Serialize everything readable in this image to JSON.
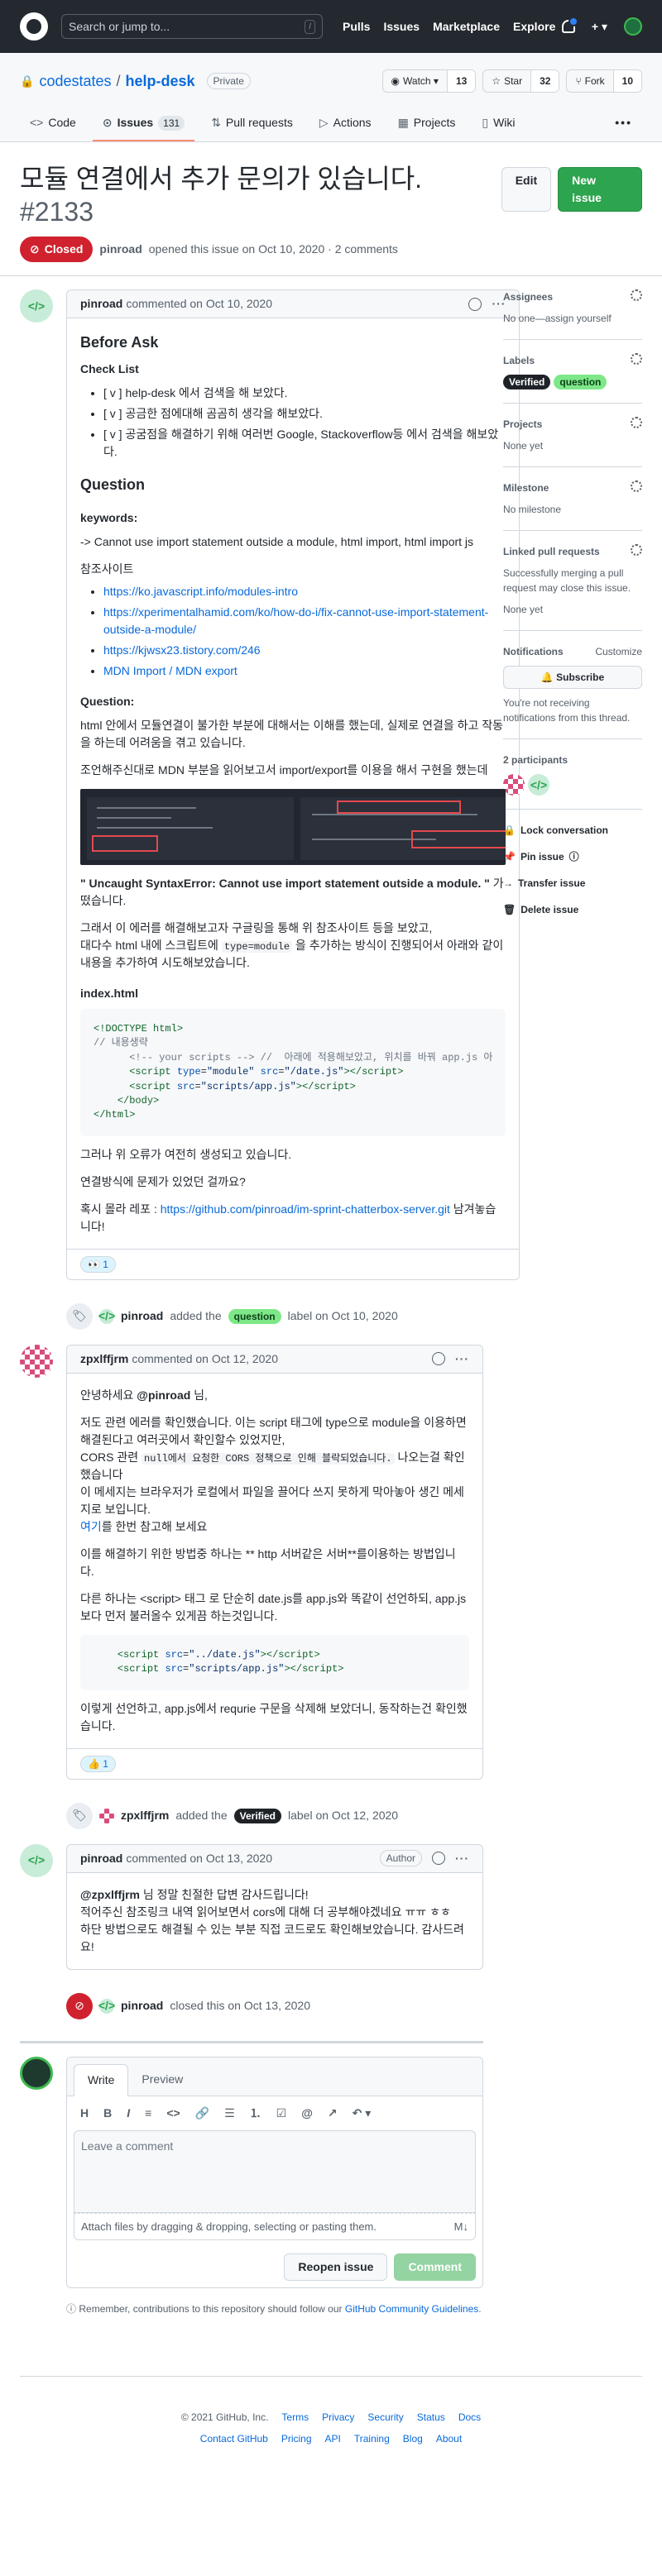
{
  "header": {
    "search_placeholder": "Search or jump to...",
    "slash": "/",
    "nav": [
      "Pulls",
      "Issues",
      "Marketplace",
      "Explore"
    ],
    "plus": "+ ▾"
  },
  "repo": {
    "owner": "codestates",
    "separator": "/",
    "name": "help-desk",
    "visibility": "Private",
    "watch_label": "Watch ▾",
    "watch_count": "13",
    "star_label": "Star",
    "star_count": "32",
    "fork_label": "Fork",
    "fork_count": "10",
    "tabs": [
      {
        "label": "Code",
        "icon": "<>"
      },
      {
        "label": "Issues",
        "icon": "⊙",
        "count": "131"
      },
      {
        "label": "Pull requests",
        "icon": "⇅"
      },
      {
        "label": "Actions",
        "icon": "▷"
      },
      {
        "label": "Projects",
        "icon": "▦"
      },
      {
        "label": "Wiki",
        "icon": "▯"
      }
    ],
    "more": "•••"
  },
  "issue": {
    "title": "모듈 연결에서 추가 문의가 있습니다.",
    "number": "#2133",
    "edit_label": "Edit",
    "new_issue_label": "New issue",
    "state": "Closed",
    "author": "pinroad",
    "meta": "opened this issue on Oct 10, 2020 · 2 comments"
  },
  "comments": {
    "first": {
      "author": "pinroad",
      "meta": "commented on Oct 10, 2020",
      "heading_before_ask": "Before Ask",
      "checklist_title": "Check List",
      "checklist": [
        "[ v ] help-desk 에서 검색을 해 보았다.",
        "[ v ] 공금한 점에대해 곰곰히 생각을 해보았다.",
        "[ v ] 공굼점을 해결하기 위해 여러번 Google, Stackoverflow등 에서 검색을 해보았다."
      ],
      "heading_question": "Question",
      "keywords_label": "keywords:",
      "keywords": "-> Cannot use import statement outside a module, html import, html import js",
      "refs_label": "참조사이트",
      "links": [
        "https://ko.javascript.info/modules-intro",
        "https://xperimentalhamid.com/ko/how-do-i/fix-cannot-use-import-statement-outside-a-module/",
        "https://kjwsx23.tistory.com/246",
        "MDN Import / MDN export"
      ],
      "question_label": "Question:",
      "q1": "html 안에서 모듈연결이 불가한 부분에 대해서는 이해를 했는데, 실제로 연결을 하고 작동을 하는데 어려움을 겪고 있습니다.",
      "q2": "조언해주신대로 MDN 부분을 읽어보고서 import/export를 이용을 해서 구현을 했는데",
      "error_text": "\" Uncaught SyntaxError: Cannot use import statement outside a module. \"",
      "error_tail": "가 떴습니다.",
      "p3a": "그래서 이 에러를 해결해보고자 구글링을 통해 위 참조사이트 등을 보았고,",
      "p3b_pre": "대다수 html 내에 스크립트에",
      "p3b_code": "type=module",
      "p3b_post": "을 추가하는 방식이 진행되어서 아래와 같이 내용을 추가하여 시도해보았습니다.",
      "code_label": "index.html",
      "q4": "그러나 위 오류가 여전히 생성되고 있습니다.",
      "q5": "연결방식에 문제가 있었던 걸까요?",
      "repo_pre": "혹시 몰라 레포 :",
      "repo_link": "https://github.com/pinroad/im-sprint-chatterbox-server.git",
      "repo_post": "남겨놓습니다!",
      "reaction_emoji": "👀",
      "reaction_count": "1"
    },
    "event1": {
      "actor": "pinroad",
      "pre": "added the",
      "label": "question",
      "post": "label on Oct 10, 2020"
    },
    "second": {
      "author": "zpxlffjrm",
      "meta": "commented on Oct 12, 2020",
      "greet_pre": "안녕하세요",
      "greet_mention": "@pinroad",
      "greet_post": "님,",
      "p1": "저도 관련 에러를 확인했습니다. 이는 script 태그에 type으로 module을 이용하면 해결된다고 여러곳에서 확인할수 있었지만,",
      "p2_pre": "CORS 관련",
      "p2_code": "null에서 요청한 CORS 정책으로 인해 블락되었습니다.",
      "p2_post": "나오는걸 확인했습니다",
      "p3": "이 메세지는 브라우저가 로컬에서 파일을 끌어다 쓰지 못하게 막아놓아 생긴 메세지로 보입니다.",
      "p4_link": "여기",
      "p4_post": "를 한번 참고해 보세요",
      "p5": "이를 해결하기 위한 방법중 하나는 ** http 서버같은 서버**를이용하는 방법입니다.",
      "p6": "다른 하나는 <script> 태그 로 단순히 date.js를 app.js와 똑같이 선언하되, app.js보다 먼저 불러올수 있게끔 하는것입니다.",
      "p7": "이렇게 선언하고, app.js에서 requrie 구문을 삭제해 보았더니, 동작하는건 확인했습니다.",
      "reaction_emoji": "👍",
      "reaction_count": "1"
    },
    "event2": {
      "actor": "zpxlffjrm",
      "pre": "added the",
      "label": "Verified",
      "post": "label on Oct 12, 2020"
    },
    "third": {
      "author": "pinroad",
      "meta": "commented on Oct 13, 2020",
      "badge": "Author",
      "mention": "@zpxlffjrm",
      "l1": "님 정말 친절한 답변 감사드립니다!",
      "l2": "적어주신 참조링크 내역 읽어보면서 cors에 대해 더 공부해야겠네요 ㅠㅠ ㅎㅎ",
      "l3": "하단 방법으로도 해결될 수 있는 부분 직접 코드로도 확인해보았습니다. 감사드려요!"
    },
    "event3": {
      "actor": "pinroad",
      "text": "closed this on Oct 13, 2020"
    }
  },
  "composer": {
    "tab_write": "Write",
    "tab_preview": "Preview",
    "tools": [
      "H",
      "B",
      "I",
      "≡",
      "<>",
      "🔗",
      "☰",
      "⒈",
      "☑",
      "@",
      "↗",
      "↶ ▾"
    ],
    "placeholder": "Leave a comment",
    "attach": "Attach files by dragging & dropping, selecting or pasting them.",
    "md": "M↓",
    "reopen": "Reopen issue",
    "comment": "Comment",
    "remember_pre": "Remember, contributions to this repository should follow our",
    "remember_link": "GitHub Community Guidelines",
    "remember_post": "."
  },
  "sidebar": {
    "assignees_title": "Assignees",
    "assignees_text": "No one—assign yourself",
    "labels_title": "Labels",
    "labels": [
      {
        "name": "Verified",
        "bg": "#1f2328",
        "fg": "#ffffff"
      },
      {
        "name": "question",
        "bg": "#7ee787",
        "fg": "#0b3f17"
      }
    ],
    "projects_title": "Projects",
    "projects_text": "None yet",
    "milestone_title": "Milestone",
    "milestone_text": "No milestone",
    "linked_title": "Linked pull requests",
    "linked_text": "Successfully merging a pull request may close this issue.",
    "linked_none": "None yet",
    "notifications_title": "Notifications",
    "customize": "Customize",
    "subscribe": "🔔 Subscribe",
    "notif_text": "You're not receiving notifications from this thread.",
    "participants": "2 participants",
    "lock": "Lock conversation",
    "pin": "Pin issue",
    "transfer": "Transfer issue",
    "delete": "Delete issue"
  },
  "footer": {
    "row1": [
      "© 2021 GitHub, Inc.",
      "Terms",
      "Privacy",
      "Security",
      "Status",
      "Docs"
    ],
    "row2": [
      "Contact GitHub",
      "Pricing",
      "API",
      "Training",
      "Blog",
      "About"
    ]
  }
}
